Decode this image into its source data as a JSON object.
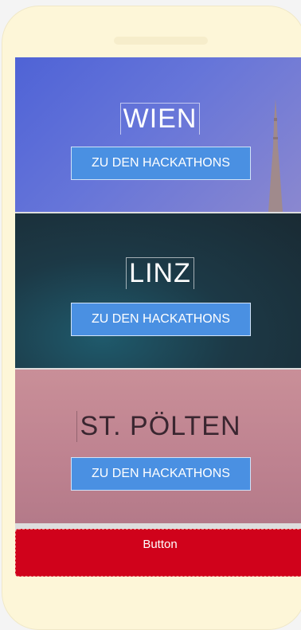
{
  "panels": [
    {
      "city": "WIEN",
      "cta": "ZU DEN HACKATHONS"
    },
    {
      "city": "LINZ",
      "cta": "ZU DEN HACKATHONS"
    },
    {
      "city": "ST. PÖLTEN",
      "cta": "ZU DEN HACKATHONS"
    }
  ],
  "footer_button": {
    "label": "Button",
    "color": "#d0021b"
  },
  "colors": {
    "phone_frame": "#fdf6d8",
    "cta_background": "#4a90e2"
  }
}
